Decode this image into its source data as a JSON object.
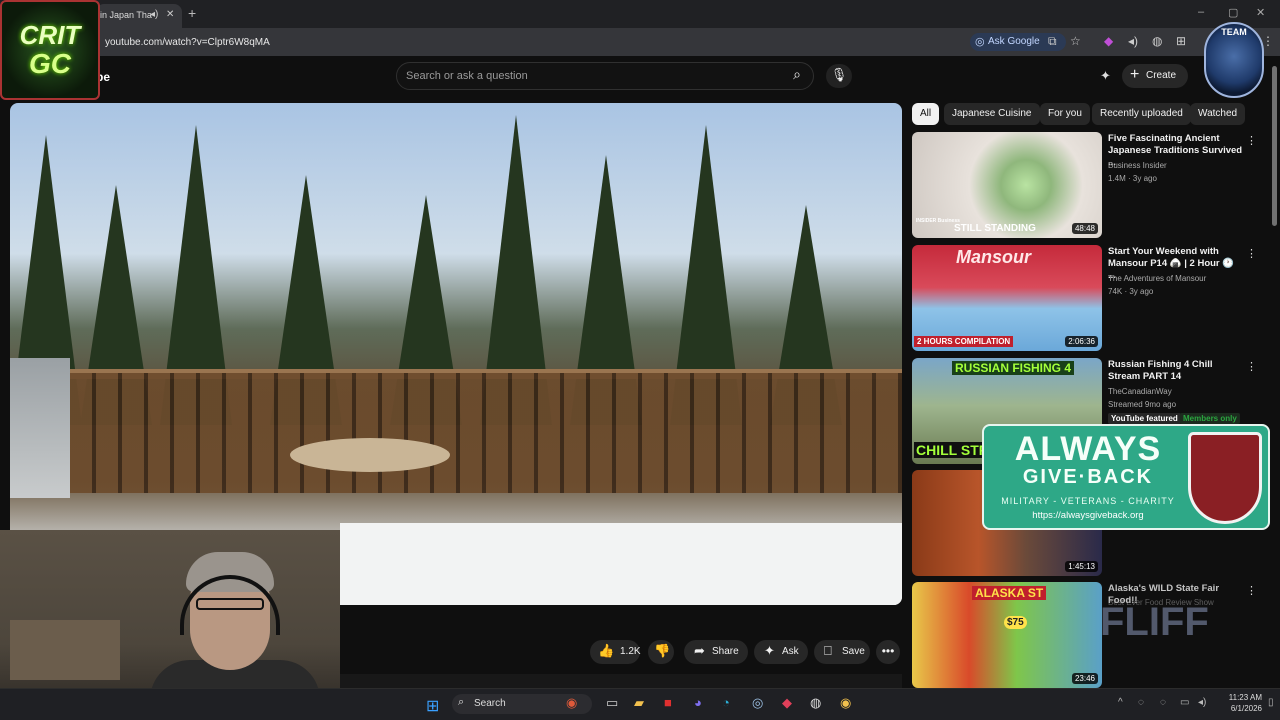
{
  "browser": {
    "tab_title": "in Japan Tha",
    "new_tab": "+",
    "url": "youtube.com/watch?v=Clptr6W8qMA",
    "ask_google": "Ask Google"
  },
  "overlays": {
    "crit_line1": "CRIT",
    "crit_line2": "GC",
    "team_text": "TEAM"
  },
  "youtube": {
    "logo_fragment": "be",
    "search_placeholder": "Search or ask a question",
    "create_label": "Create"
  },
  "actions": {
    "likes": "1.2K",
    "share": "Share",
    "ask": "Ask",
    "save": "Save"
  },
  "chips": [
    "All",
    "Japanese Cuisine",
    "For you",
    "Recently uploaded",
    "Watched"
  ],
  "suggestions": [
    {
      "title": "Five Fascinating Ancient Japanese Traditions Survived ...",
      "channel": "Business Insider",
      "meta": "1.4M · 3y ago",
      "duration": "48:48",
      "overlay": "STILL STANDING",
      "overlay_small": "INSIDER Business"
    },
    {
      "title": "Start Your Weekend with Mansour P14 🍙 | 2 Hour 🕐 ...",
      "channel": "The Adventures of Mansour",
      "meta": "74K · 3y ago",
      "duration": "2:06:36",
      "overlay": "2 HOURS COMPILATION",
      "overlay_small": "Mansour"
    },
    {
      "title": "Russian Fishing 4 Chill Stream PART 14",
      "channel": "TheCanadianWay",
      "meta": "Streamed 9mo ago",
      "badge_featured": "YouTube featured",
      "badge_members": "Members only",
      "overlay": "RUSSIAN FISHING 4",
      "overlay_small": "CHILL STRE"
    },
    {
      "title": "",
      "duration": "1:45:13"
    },
    {
      "title": "Alaska's WILD State Fair Food!!",
      "channel": "Best Ever Food Review Show",
      "duration": "23:46",
      "overlay": "ALASKA ST",
      "overlay_small": "$75",
      "watermark": "FLIFF"
    }
  ],
  "agb": {
    "line1": "ALWAYS",
    "line2": "GIVE·BACK",
    "line3": "MILITARY - VETERANS - CHARITY",
    "url": "https://alwaysgiveback.org"
  },
  "taskbar": {
    "search": "Search",
    "time": "11:23 AM",
    "date": "6/1/2026"
  }
}
